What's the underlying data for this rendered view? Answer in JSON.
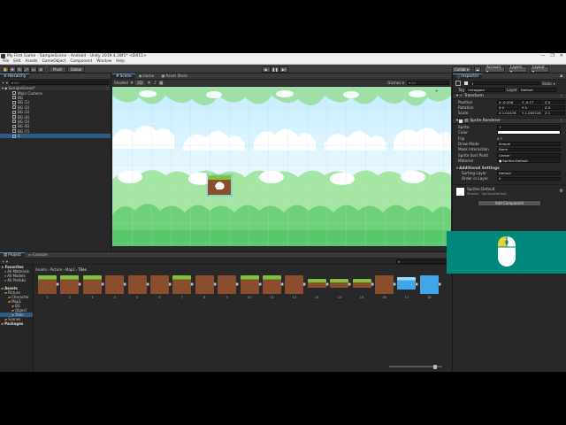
{
  "window": {
    "title": "My First Game - SampleScene - Android - Unity 2019.4.28f1* <DX11>",
    "controls": [
      "—",
      "❐",
      "✕"
    ]
  },
  "menu": [
    "File",
    "Edit",
    "Assets",
    "GameObject",
    "Component",
    "Window",
    "Help"
  ],
  "toolbar": {
    "pivot": "Pivot",
    "global": "Global",
    "collab": "Collab ▾",
    "account": "Account ▾",
    "layers": "Layers ▾",
    "layout": "Layout ▾"
  },
  "hierarchy": {
    "tab": "Hierarchy",
    "search_placeholder": "All",
    "scene": "SampleScene*",
    "items": [
      "Main Camera",
      "BG",
      "BG (1)",
      "BG (2)",
      "BG (3)",
      "BG (4)",
      "BG (5)",
      "BG (6)",
      "BG (7)",
      "1"
    ]
  },
  "scene": {
    "tabs": [
      "Scene",
      "Game",
      "Asset Store"
    ],
    "shading": "Shaded",
    "mode": "2D",
    "gizmos": "Gizmos ▾",
    "search_placeholder": "All"
  },
  "inspector": {
    "tab": "Inspector",
    "name": "1",
    "static": "Static ▾",
    "tag_label": "Tag",
    "tag": "Untagged",
    "layer_label": "Layer",
    "layer": "Default",
    "transform": {
      "header": "Transform",
      "position_label": "Position",
      "rotation_label": "Rotation",
      "scale_label": "Scale",
      "position": [
        "X -0.208",
        "Y -0.17",
        "Z 0"
      ],
      "rotation": [
        "X 0",
        "Y 0",
        "Z 0"
      ],
      "scale": [
        "X 1.02478",
        "Y 1.005728",
        "Z 1"
      ]
    },
    "sprite_renderer": {
      "header": "Sprite Renderer",
      "sprite_label": "Sprite",
      "sprite": "1",
      "color_label": "Color",
      "flip_label": "Flip",
      "flip": "X   Y",
      "draw_mode_label": "Draw Mode",
      "draw_mode": "Simple",
      "mask_label": "Mask Interaction",
      "mask": "None",
      "sort_point_label": "Sprite Sort Point",
      "sort_point": "Center",
      "material_label": "Material",
      "material": "Sprites-Default"
    },
    "additional": {
      "header": "Additional Settings",
      "sorting_layer_label": "Sorting Layer",
      "sorting_layer": "Default",
      "order_label": "Order in Layer",
      "order": "0"
    },
    "material_block": {
      "name": "Sprites-Default",
      "shader_label": "Shader",
      "shader": "Sprites/Default"
    },
    "add_component": "Add Component"
  },
  "project": {
    "tabs": [
      "Project",
      "Console"
    ],
    "favorites": "Favorites",
    "fav_items": [
      "All Materials",
      "All Models",
      "All Prefabs"
    ],
    "assets": "Assets",
    "asset_items": [
      "Picture",
      "Character",
      "Map1",
      "BG",
      "Object",
      "Tiles",
      "Scenes"
    ],
    "packages": "Packages",
    "breadcrumb": [
      "Assets",
      "Picture",
      "Map1",
      "Tiles"
    ],
    "tile_labels": [
      "1",
      "2",
      "3",
      "4",
      "5",
      "6",
      "7",
      "8",
      "9",
      "10",
      "11",
      "12",
      "13",
      "14",
      "15",
      "16",
      "17",
      "18"
    ]
  },
  "colors": {
    "accent": "#4c8fd6",
    "selection": "#2c5d87",
    "grass": "#7ec33b",
    "dirt": "#8a4e2e",
    "water": "#3fa7e8",
    "overlay": "#00897b"
  },
  "icons": {
    "play": "play-icon",
    "pause": "pause-icon",
    "step": "step-icon",
    "mouse": "mouse-icon"
  }
}
